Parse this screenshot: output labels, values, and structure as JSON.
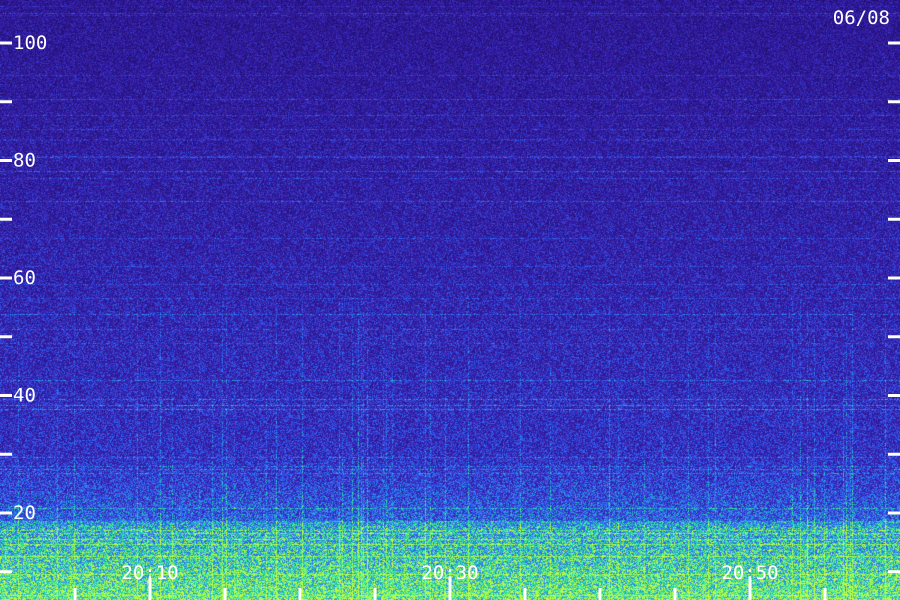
{
  "chart_data": {
    "type": "heatmap",
    "title": "",
    "date_label": "06/08",
    "xlabel": "",
    "ylabel": "",
    "y_axis": {
      "range": [
        0,
        100
      ],
      "ticks": [
        {
          "value": 100,
          "label": "100"
        },
        {
          "value": 90,
          "label": ""
        },
        {
          "value": 80,
          "label": "80"
        },
        {
          "value": 70,
          "label": ""
        },
        {
          "value": 60,
          "label": "60"
        },
        {
          "value": 50,
          "label": ""
        },
        {
          "value": 40,
          "label": "40"
        },
        {
          "value": 30,
          "label": ""
        },
        {
          "value": 20,
          "label": "20"
        },
        {
          "value": 10,
          "label": ""
        }
      ]
    },
    "x_axis": {
      "range": [
        "20:00",
        "21:00"
      ],
      "ticks": [
        {
          "time": "20:05",
          "label": ""
        },
        {
          "time": "20:10",
          "label": "20:10"
        },
        {
          "time": "20:15",
          "label": ""
        },
        {
          "time": "20:20",
          "label": ""
        },
        {
          "time": "20:25",
          "label": ""
        },
        {
          "time": "20:30",
          "label": "20:30"
        },
        {
          "time": "20:35",
          "label": ""
        },
        {
          "time": "20:40",
          "label": ""
        },
        {
          "time": "20:45",
          "label": ""
        },
        {
          "time": "20:50",
          "label": "20:50"
        },
        {
          "time": "20:55",
          "label": ""
        }
      ]
    },
    "colors": {
      "background": "#1f0f6e",
      "low": "#3a1fb0",
      "mid": "#2f6cff",
      "high": "#28e8a0",
      "peak": "#c8ff3c",
      "axis": "#ffffff"
    },
    "grid": false
  }
}
